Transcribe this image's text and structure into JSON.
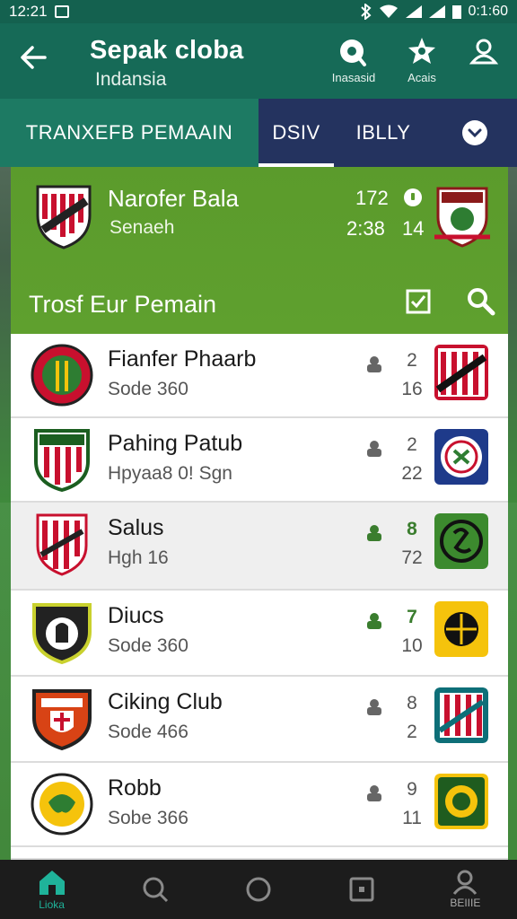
{
  "status_bar": {
    "time": "12:21",
    "right_time": "0:1:60"
  },
  "app_bar": {
    "title": "Sepak cloba",
    "subtitle": "Indansia",
    "actions": [
      {
        "label": "Inasasid",
        "icon": "whistle-icon"
      },
      {
        "label": "Acais",
        "icon": "trophy-icon"
      },
      {
        "label": "",
        "icon": "profile-icon"
      }
    ]
  },
  "tabs": [
    {
      "label": "TRANXEFB PEMAAIN",
      "active": true
    },
    {
      "label": "DSIV",
      "underlined": true
    },
    {
      "label": "IBLLY"
    }
  ],
  "match": {
    "team_name": "Narofer Bala",
    "team_sub": "Senaeh",
    "num_top": "172",
    "time": "2:38",
    "num_bottom": "14"
  },
  "section": {
    "title": "Trosf Eur Pemain"
  },
  "players": [
    {
      "name": "Fianfer Phaarb",
      "sub": "Sode 360",
      "n1": "2",
      "n2": "16",
      "accent": false,
      "badge_color": "#c8102e",
      "logo_color": "#c8102e"
    },
    {
      "name": "Pahing Patub",
      "sub": "Hpyaa8 0! Sgn",
      "n1": "2",
      "n2": "22",
      "accent": false,
      "badge_color": "#1e3a8a",
      "logo_color": "#1b5e20"
    },
    {
      "name": "Salus",
      "sub": "Hgh 16",
      "n1": "8",
      "n2": "72",
      "accent": true,
      "badge_color": "#3c8a2e",
      "logo_color": "#c8102e"
    },
    {
      "name": "Diucs",
      "sub": "Sode 360",
      "n1": "7",
      "n2": "10",
      "accent": true,
      "badge_color": "#f5c30c",
      "logo_color": "#222222"
    },
    {
      "name": "Ciking Club",
      "sub": "Sode 466",
      "n1": "8",
      "n2": "2",
      "accent": false,
      "badge_color": "#0e6f78",
      "logo_color": "#d84315"
    },
    {
      "name": "Robb",
      "sub": "Sobe 366",
      "n1": "9",
      "n2": "11",
      "accent": false,
      "badge_color": "#1f5c1f",
      "logo_color": "#2e7d32"
    }
  ],
  "bottom_nav": [
    {
      "label": "Lioka",
      "icon": "home-icon",
      "active": true
    },
    {
      "label": "",
      "icon": "search-icon"
    },
    {
      "label": "",
      "icon": "circle-icon"
    },
    {
      "label": "",
      "icon": "square-icon"
    },
    {
      "label": "BEIIIE",
      "icon": "profile-icon"
    }
  ],
  "colors": {
    "accent_green": "#5b9b2c",
    "header_teal": "#166a57",
    "tab_navy": "#24335f"
  }
}
